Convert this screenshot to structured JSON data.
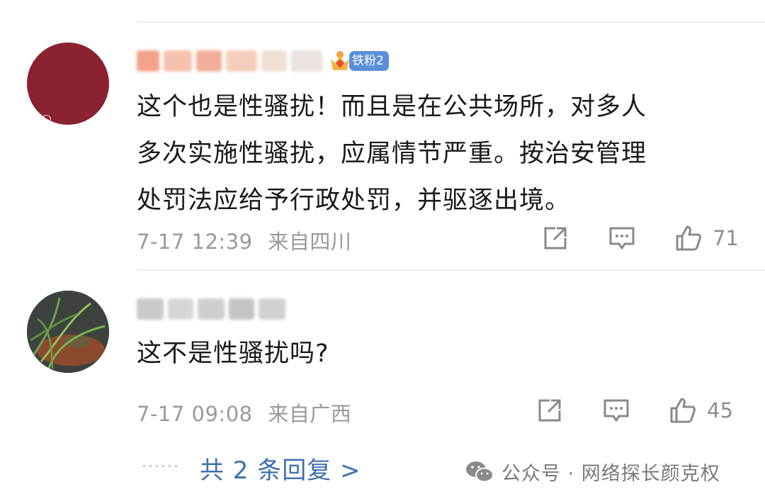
{
  "comments": [
    {
      "badge_label": "铁粉2",
      "text_lines": [
        "这个也是性骚扰！而且是在公共场所，对多人",
        "多次实施性骚扰，应属情节严重。按治安管理",
        "处罚法应给予行政处罚，并驱逐出境。"
      ],
      "timestamp": "7-17 12:39",
      "location": "来自四川",
      "like_count": "71",
      "avatar_mark": "ED"
    },
    {
      "text_lines": [
        "这不是性骚扰吗?"
      ],
      "timestamp": "7-17 09:08",
      "location": "来自广西",
      "like_count": "45"
    }
  ],
  "replies_link": "共 2 条回复 >",
  "ellipsis": "......",
  "watermark": "公众号 · 网络探长颜克权",
  "icons": [
    "share-icon",
    "comment-icon",
    "like-icon",
    "wechat-icon"
  ],
  "colors": {
    "accent": "#3c6fb3",
    "badge": "#5b8fd9",
    "avatar1": "#8b2231"
  }
}
